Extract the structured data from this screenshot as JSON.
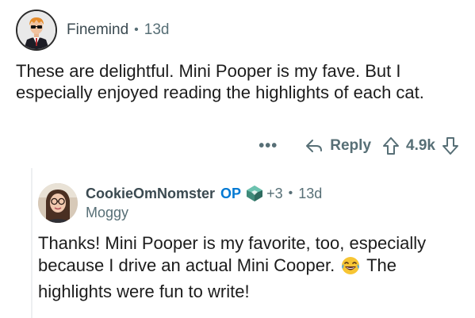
{
  "comment1": {
    "username": "Finemind",
    "age": "13d",
    "body": "These are delightful. Mini Pooper is my fave. But I especially enjoyed reading the highlights of each cat.",
    "actions": {
      "more": "•••",
      "reply_label": "Reply",
      "score": "4.9k",
      "icons": [
        "reply-arrow-icon",
        "upvote-arrow-icon",
        "downvote-arrow-icon"
      ]
    }
  },
  "comment2": {
    "username": "CookieOmNomster",
    "op_badge": "OP",
    "flair_extra": "+3",
    "age": "13d",
    "flair_text": "Moggy",
    "body_part1": "Thanks! Mini Pooper is my favorite, too, especially because I drive an actual Mini Cooper.",
    "emoji": "laughing-crying-emoji",
    "body_part2": "The highlights were fun to write!"
  },
  "separator": "•",
  "colors": {
    "meta_gray": "#576f76",
    "op_blue": "#0079d3",
    "thread_line": "#edeff1"
  }
}
